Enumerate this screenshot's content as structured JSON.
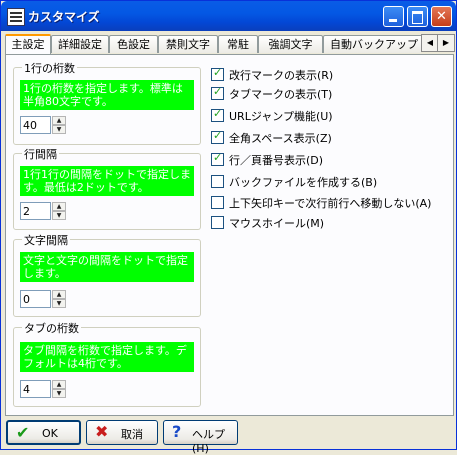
{
  "window": {
    "title": "カスタマイズ"
  },
  "tabs": [
    {
      "label": "主設定",
      "active": true
    },
    {
      "label": "詳細設定"
    },
    {
      "label": "色設定"
    },
    {
      "label": "禁則文字"
    },
    {
      "label": "常駐"
    },
    {
      "label": "強調文字"
    },
    {
      "label": "自動バックアップ"
    }
  ],
  "groups": {
    "line_digits": {
      "label": "1行の桁数",
      "note": "1行の桁数を指定します。標準は半角80文字です。",
      "value": "40"
    },
    "line_spacing": {
      "label": "行間隔",
      "note": "1行1行の間隔をドットで指定します。最低は2ドットです。",
      "value": "2"
    },
    "char_spacing": {
      "label": "文字間隔",
      "note": "文字と文字の間隔をドットで指定します。",
      "value": "0"
    },
    "tab_digits": {
      "label": "タブの桁数",
      "note": "タブ間隔を桁数で指定します。デフォルトは4桁です。",
      "value": "4"
    }
  },
  "options": [
    {
      "label": "改行マークの表示(R)",
      "checked": true
    },
    {
      "label": "タブマークの表示(T)",
      "checked": true
    },
    {
      "label": "URLジャンプ機能(U)",
      "checked": true
    },
    {
      "label": "全角スペース表示(Z)",
      "checked": true
    },
    {
      "label": "行／頁番号表示(D)",
      "checked": true
    },
    {
      "label": "バックファイルを作成する(B)",
      "checked": false
    },
    {
      "label": "上下矢印キーで次行前行へ移動しない(A)",
      "checked": false
    },
    {
      "label": "マウスホイール(M)",
      "checked": false
    }
  ],
  "buttons": {
    "ok": "OK",
    "cancel": "取消",
    "help": "ヘルプ(H)"
  },
  "icons": {
    "app": "editor-app-icon",
    "ok": "checkmark-icon",
    "cancel": "x-icon",
    "help": "question-icon"
  },
  "colors": {
    "note_bg": "#00ff00",
    "title_blue": "#0458e4",
    "tab_highlight": "#ff9a00"
  }
}
